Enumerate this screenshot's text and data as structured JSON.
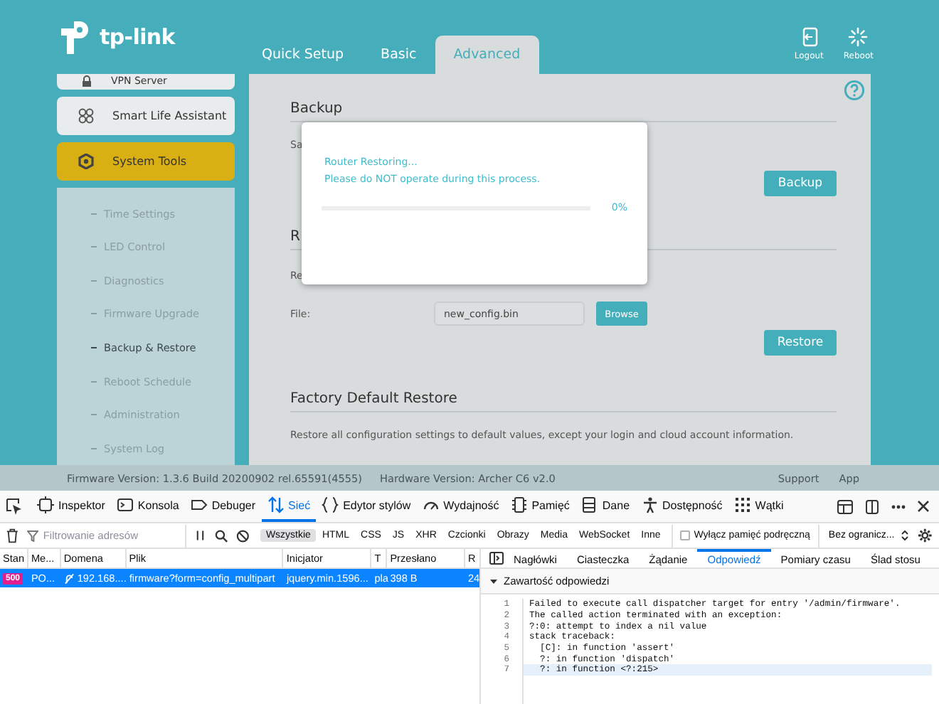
{
  "router": {
    "logo": "tp-link",
    "tabs": [
      {
        "label": "Quick Setup",
        "selected": false
      },
      {
        "label": "Basic",
        "selected": false
      },
      {
        "label": "Advanced",
        "selected": true
      }
    ],
    "actions": [
      {
        "label": "Logout",
        "kind": "logout"
      },
      {
        "label": "Reboot",
        "kind": "reboot"
      }
    ],
    "sidebar": {
      "items": [
        {
          "label": "VPN Server",
          "kind": "vpn",
          "selected": false
        },
        {
          "label": "Smart Life Assistant",
          "kind": "smart",
          "selected": false
        },
        {
          "label": "System Tools",
          "kind": "tools",
          "selected": true
        }
      ],
      "subitems": [
        {
          "label": "Time Settings",
          "selected": false
        },
        {
          "label": "LED Control",
          "selected": false
        },
        {
          "label": "Diagnostics",
          "selected": false
        },
        {
          "label": "Firmware Upgrade",
          "selected": false
        },
        {
          "label": "Backup & Restore",
          "selected": true
        },
        {
          "label": "Reboot Schedule",
          "selected": false
        },
        {
          "label": "Administration",
          "selected": false
        },
        {
          "label": "System Log",
          "selected": false
        }
      ]
    },
    "sections": [
      {
        "title": "Backup",
        "note": "Sa",
        "button": "Backup"
      },
      {
        "title": "R",
        "note": "Re",
        "file_label": "File:",
        "file_value": "new_config.bin",
        "browse": "Browse",
        "button": "Restore"
      },
      {
        "title": "Factory Default Restore",
        "note": "Restore all configuration settings to default values, except your login and cloud account information."
      }
    ],
    "footer": {
      "firmware": "Firmware Version: 1.3.6 Build 20200902 rel.65591(4555)",
      "hardware": "Hardware Version: Archer C6 v2.0",
      "links": [
        "Support",
        "App"
      ]
    },
    "dialog": {
      "lines": [
        "Router Restoring...",
        "Please do NOT operate during this process."
      ],
      "level": 0,
      "reading": "0%"
    }
  },
  "devtools": {
    "tools": [
      {
        "label": "Inspektor",
        "kind": "inspector",
        "selected": false
      },
      {
        "label": "Konsola",
        "kind": "console",
        "selected": false
      },
      {
        "label": "Debuger",
        "kind": "debugger",
        "selected": false
      },
      {
        "label": "Sieć",
        "kind": "network",
        "selected": true
      },
      {
        "label": "Edytor stylów",
        "kind": "style",
        "selected": false
      },
      {
        "label": "Wydajność",
        "kind": "performance",
        "selected": false
      },
      {
        "label": "Pamięć",
        "kind": "memory",
        "selected": false
      },
      {
        "label": "Dane",
        "kind": "storage",
        "selected": false
      },
      {
        "label": "Dostępność",
        "kind": "accessibility",
        "selected": false
      },
      {
        "label": "Wątki",
        "kind": "threads",
        "selected": false
      }
    ],
    "filter": {
      "placeholder": "Filtrowanie adresów"
    },
    "types": [
      {
        "label": "Wszystkie",
        "selected": true
      },
      {
        "label": "HTML",
        "selected": false
      },
      {
        "label": "CSS",
        "selected": false
      },
      {
        "label": "JS",
        "selected": false
      },
      {
        "label": "XHR",
        "selected": false
      },
      {
        "label": "Czcionki",
        "selected": false
      },
      {
        "label": "Obrazy",
        "selected": false
      },
      {
        "label": "Media",
        "selected": false
      },
      {
        "label": "WebSocket",
        "selected": false
      },
      {
        "label": "Inne",
        "selected": false
      }
    ],
    "cache": {
      "label": "Wyłącz pamięć podręczną",
      "checked": false
    },
    "throttle": "Bez ogranicz...",
    "columns": [
      "Stan",
      "Me...",
      "Domena",
      "Plik",
      "Inicjator",
      "T",
      "Przesłano",
      "R"
    ],
    "requests": [
      {
        "status": "500",
        "method": "PO...",
        "domain": "192.168....",
        "file": "firmware?form=config_multipart",
        "initiator": "jquery.min.1596...",
        "type": "pla",
        "size": "398 B",
        "column_8": "24",
        "selected": true
      }
    ],
    "panel_tabs": [
      {
        "label": "Nagłówki",
        "selected": false
      },
      {
        "label": "Ciasteczka",
        "selected": false
      },
      {
        "label": "Żądanie",
        "selected": false
      },
      {
        "label": "Odpowiedź",
        "selected": true
      },
      {
        "label": "Pomiary czasu",
        "selected": false
      },
      {
        "label": "Ślad stosu",
        "selected": false
      }
    ],
    "response": {
      "section": "Zawartość odpowiedzi",
      "expanded": true,
      "lines": [
        {
          "number": "1",
          "text": "Failed to execute call dispatcher target for entry '/admin/firmware'.",
          "highlighted": false
        },
        {
          "number": "2",
          "text": "The called action terminated with an exception:",
          "highlighted": false
        },
        {
          "number": "3",
          "text": "?:0: attempt to index a nil value",
          "highlighted": false
        },
        {
          "number": "4",
          "text": "stack traceback:",
          "highlighted": false
        },
        {
          "number": "5",
          "text": "  [C]: in function 'assert'",
          "highlighted": false
        },
        {
          "number": "6",
          "text": "  ?: in function 'dispatch'",
          "highlighted": false
        },
        {
          "number": "7",
          "text": "  ?: in function <?:215>",
          "highlighted": true
        }
      ]
    }
  }
}
